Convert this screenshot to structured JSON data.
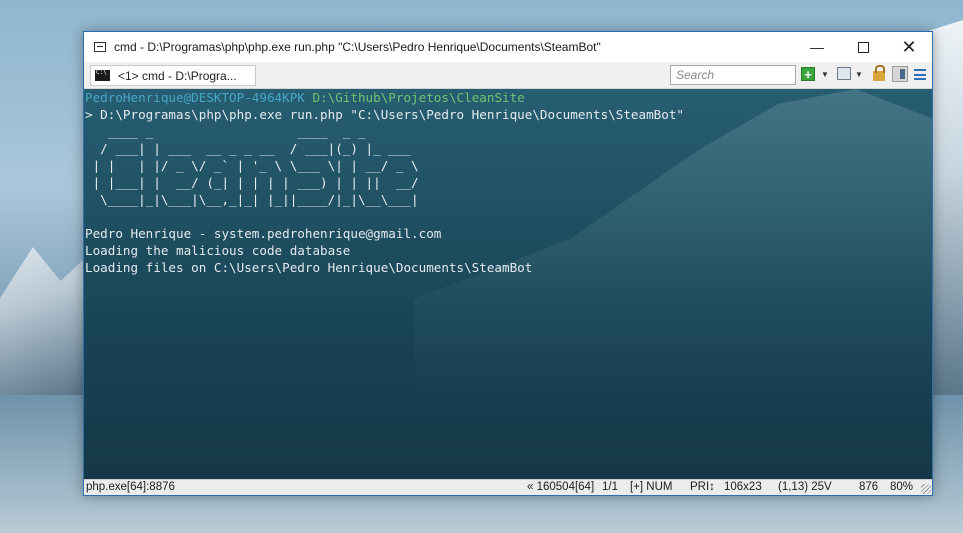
{
  "window": {
    "title": "cmd - D:\\Programas\\php\\php.exe  run.php \"C:\\Users\\Pedro Henrique\\Documents\\SteamBot\"",
    "minimize_glyph": "—",
    "close_glyph": "✕"
  },
  "tabbar": {
    "tab_label": "<1>  cmd - D:\\Progra...",
    "search_placeholder": "Search",
    "new_console_glyph": "+",
    "dropdown_glyph": "▼"
  },
  "console": {
    "prompt_user": "PedroHenrique@DESKTOP-4964KPK",
    "prompt_path": " D:\\Github\\Projetos\\CleanSite",
    "command": "> D:\\Programas\\php\\php.exe run.php \"C:\\Users\\Pedro Henrique\\Documents\\SteamBot\"",
    "banner": "   ____ _                   ____  _ _\n  / ___| | ___  __ _ _ __  / ___|(_) |_ ___\n | |   | |/ _ \\/ _` | '_ \\ \\___ \\| | __/ _ \\\n | |___| |  __/ (_| | | | | ___) | | ||  __/\n  \\____|_|\\___|\\__,_|_| |_||____/|_|\\__\\___|",
    "author_line": "Pedro Henrique - system.pedrohenrique@gmail.com",
    "loading_line_1": "Loading the malicious code database",
    "loading_line_2": "Loading files on C:\\Users\\Pedro Henrique\\Documents\\SteamBot"
  },
  "statusbar": {
    "process": "php.exe[64]:8876",
    "pid_info": "« 160504[64]",
    "pages": "1/1",
    "plus_num": "[+] NUM",
    "pri": "PRI↕",
    "size": "106x23",
    "cursor": "(1,13) 25V",
    "value": "876",
    "zoom": "80%"
  },
  "colors": {
    "prompt_user": "#46a7c4",
    "prompt_path": "#6fc46f",
    "window_border": "#2b6fb0"
  }
}
